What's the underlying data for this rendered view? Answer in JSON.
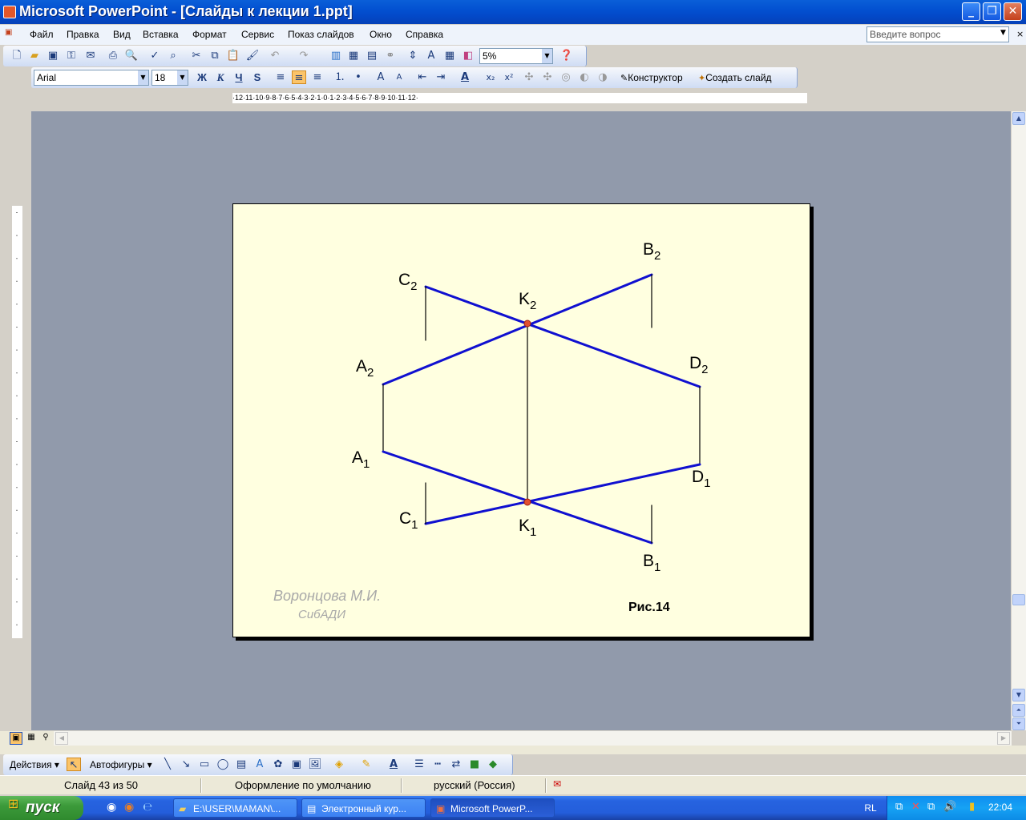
{
  "window": {
    "title": "Microsoft PowerPoint - [Слайды к лекции 1.ppt]"
  },
  "menu": {
    "items": [
      "Файл",
      "Правка",
      "Вид",
      "Вставка",
      "Формат",
      "Сервис",
      "Показ слайдов",
      "Окно",
      "Справка"
    ],
    "ask_placeholder": "Введите вопрос"
  },
  "toolbar": {
    "zoom": "5%"
  },
  "format_toolbar": {
    "font": "Arial",
    "size": "18",
    "bold": "Ж",
    "italic": "К",
    "underline": "Ч",
    "shadow": "S",
    "designer_label": "Конструктор",
    "new_slide_label": "Создать слайд"
  },
  "ruler": {
    "h_ticks": "·12·11·10·9·8·7·6·5·4·3·2·1·0·1·2·3·4·5·6·7·8·9·10·11·12·"
  },
  "slide": {
    "labels": {
      "B2": [
        "B",
        "2"
      ],
      "C2": [
        "C",
        "2"
      ],
      "K2": [
        "K",
        "2"
      ],
      "A2": [
        "A",
        "2"
      ],
      "D2": [
        "D",
        "2"
      ],
      "A1": [
        "A",
        "1"
      ],
      "D1": [
        "D",
        "1"
      ],
      "C1": [
        "C",
        "1"
      ],
      "K1": [
        "K",
        "1"
      ],
      "B1": [
        "B",
        "1"
      ]
    },
    "author": "Воронцова М.И.",
    "org": "СибАДИ",
    "figure": "Рис.14",
    "line_color": "#1010d0",
    "point_color": "#e05030"
  },
  "drawing_toolbar": {
    "actions": "Действия",
    "autoshapes": "Автофигуры"
  },
  "status": {
    "slide": "Слайд 43 из 50",
    "design": "Оформление по умолчанию",
    "language": "русский (Россия)"
  },
  "taskbar": {
    "start": "пуск",
    "tasks": [
      "E:\\USER\\MAMAN\\...",
      "Электронный кур...",
      "Microsoft PowerP..."
    ],
    "lang": "RL",
    "time": "22:04"
  }
}
